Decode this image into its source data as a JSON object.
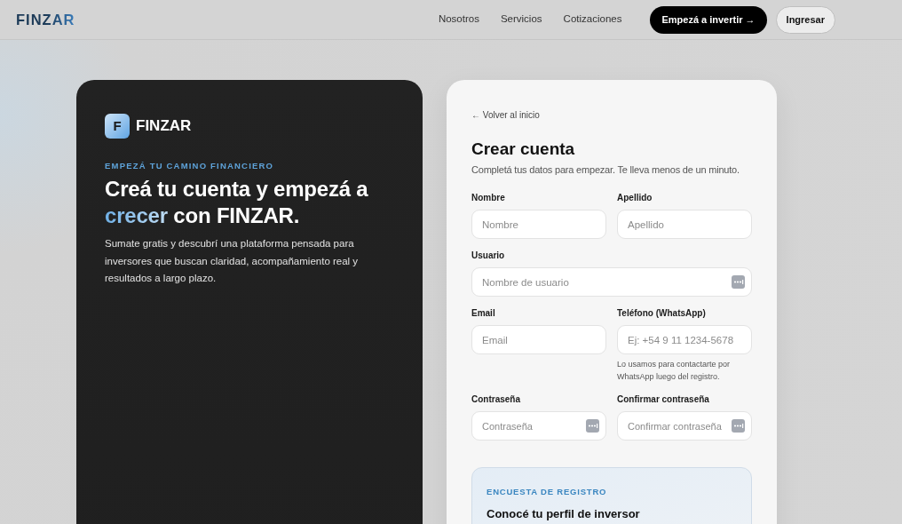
{
  "header": {
    "logo": "FINZAR",
    "nav": [
      {
        "label": "Nosotros"
      },
      {
        "label": "Servicios"
      },
      {
        "label": "Cotizaciones"
      }
    ],
    "cta": "Empezá a invertir →",
    "login": "Ingresar"
  },
  "intro": {
    "badge": "F",
    "brand": "FINZAR",
    "eyebrow": "EMPEZÁ TU CAMINO FINANCIERO",
    "heading": {
      "before": "Creá tu cuenta y empezá a",
      "highlight": "crecer",
      "after": "con FINZAR."
    },
    "body": "Sumate gratis y descubrí una plataforma pensada para inversores que buscan claridad, acompañamiento real y resultados a largo plazo."
  },
  "form": {
    "back_link": "← Volver al inicio",
    "title": "Crear cuenta",
    "subtitle": "Completá tus datos para empezar. Te lleva menos de un minuto.",
    "rows": [
      [
        {
          "label": "Nombre",
          "placeholder": "Nombre",
          "autofill_icon": false
        },
        {
          "label": "Apellido",
          "placeholder": "Apellido",
          "autofill_icon": false
        }
      ],
      [
        {
          "label": "Usuario",
          "placeholder": "Nombre de usuario",
          "autofill_icon": true
        }
      ],
      [
        {
          "label": "Email",
          "placeholder": "Email",
          "autofill_icon": false
        },
        {
          "label": "Teléfono (WhatsApp)",
          "placeholder": "Ej: +54 9 11 1234-5678",
          "autofill_icon": false,
          "hint": "Lo usamos para contactarte por WhatsApp luego del registro."
        }
      ],
      [
        {
          "label": "Contraseña",
          "placeholder": "Contraseña",
          "autofill_icon": true
        },
        {
          "label": "Confirmar contraseña",
          "placeholder": "Confirmar contraseña",
          "autofill_icon": true
        }
      ]
    ]
  },
  "survey": {
    "eyebrow": "ENCUESTA DE REGISTRO",
    "title": "Conocé tu perfil de inversor"
  }
}
